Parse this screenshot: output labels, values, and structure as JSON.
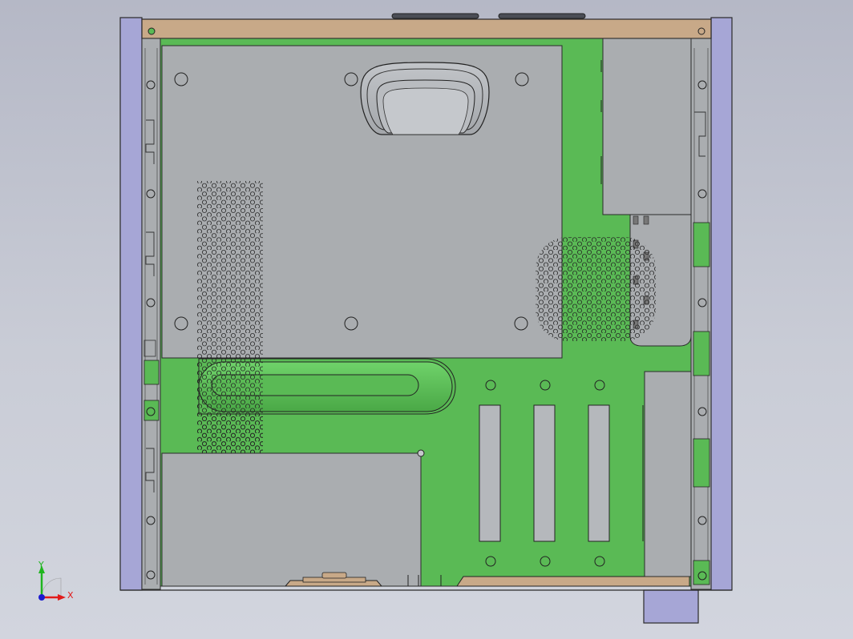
{
  "viewport": {
    "background_top": "#b5b8c6",
    "background_bottom": "#d2d5de"
  },
  "colors": {
    "side_panel": "#a6a6d6",
    "top_rail": "#c8a988",
    "motherboard": "#5aba55",
    "sheet_metal": "#aaadb0",
    "sheet_metal_dark": "#9a9da2",
    "outline": "#2a2a2a",
    "expansion_slot": "#b5b8bc",
    "axis_x": "#e11b1b",
    "axis_y": "#1fb51f",
    "axis_z": "#1b1bd0"
  },
  "triad": {
    "x_label": "X",
    "y_label": "Y"
  },
  "icons": {
    "triad": "coordinate-axes-icon"
  }
}
